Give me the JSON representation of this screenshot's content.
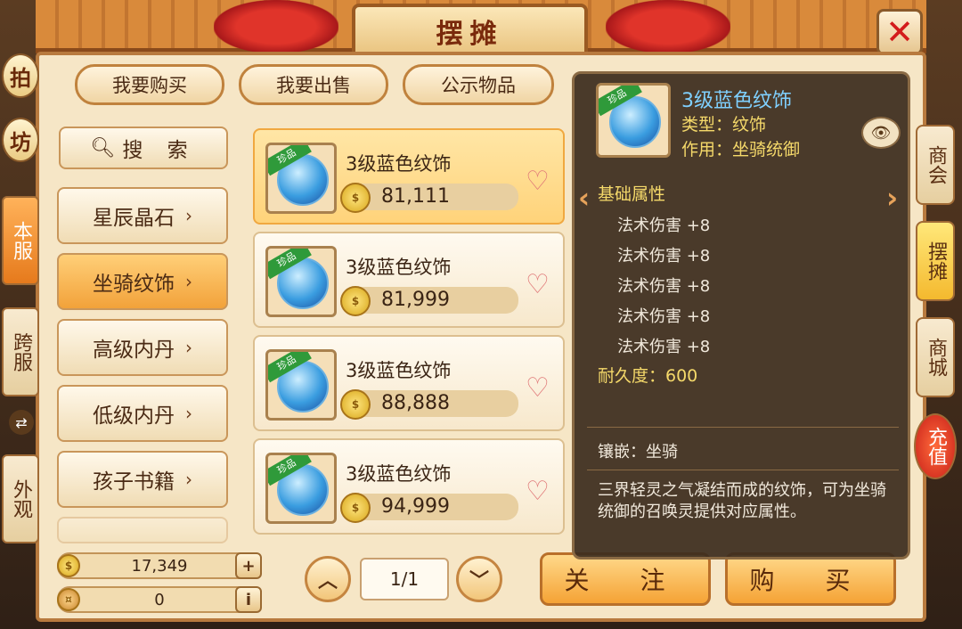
{
  "window": {
    "title": "摆摊"
  },
  "left_tabs": {
    "top1": "拍",
    "top2": "坊",
    "server_local": "本服",
    "server_cross": "跨服",
    "appearance": "外观"
  },
  "top_tabs": [
    "我要购买",
    "我要出售",
    "公示物品"
  ],
  "search_label": "搜 索",
  "categories": [
    {
      "label": "星辰晶石"
    },
    {
      "label": "坐骑纹饰",
      "active": true
    },
    {
      "label": "高级内丹"
    },
    {
      "label": "低级内丹"
    },
    {
      "label": "孩子书籍"
    }
  ],
  "listings": [
    {
      "name": "3级蓝色纹饰",
      "price": "81,111",
      "badge": "珍品"
    },
    {
      "name": "3级蓝色纹饰",
      "price": "81,999",
      "badge": "珍品"
    },
    {
      "name": "3级蓝色纹饰",
      "price": "88,888",
      "badge": "珍品"
    },
    {
      "name": "3级蓝色纹饰",
      "price": "94,999",
      "badge": "珍品"
    }
  ],
  "currency": {
    "gold": "17,349",
    "silver": "0"
  },
  "pager": {
    "page": "1/1"
  },
  "actions": {
    "follow": "关 注",
    "buy": "购 买"
  },
  "right_tabs": [
    "商会",
    "摆摊",
    "商城",
    "充值"
  ],
  "tooltip": {
    "name": "3级蓝色纹饰",
    "badge": "珍品",
    "type": "类型：纹饰",
    "effect": "作用：坐骑统御",
    "section": "基础属性",
    "attrs": [
      "法术伤害 +8",
      "法术伤害 +8",
      "法术伤害 +8",
      "法术伤害 +8",
      "法术伤害 +8"
    ],
    "durability": "耐久度：600",
    "inlay": "镶嵌：坐骑",
    "description": "三界轻灵之气凝结而成的纹饰，可为坐骑统御的召唤灵提供对应属性。"
  },
  "colors": {
    "panel_bg": "#f6e6c6",
    "accent_orange": "#f2a23a",
    "tooltip_bg": "#3c2c1e",
    "title_blue": "#7fd0ff",
    "attr_yellow": "#f5d96a"
  }
}
